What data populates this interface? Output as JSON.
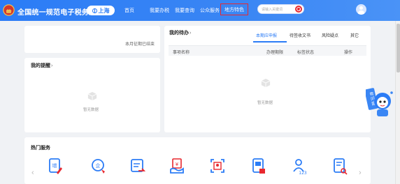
{
  "header": {
    "brand": "全国统一规范电子税务局",
    "region": "上海",
    "nav": [
      {
        "label": "首页"
      },
      {
        "label": "我要办税"
      },
      {
        "label": "我要查询"
      },
      {
        "label": "公众服务"
      },
      {
        "label": "地方特色"
      }
    ],
    "search": {
      "placeholder": "请输入关键词"
    },
    "colors": {
      "primary": "#2b7cf6",
      "highlight": "#e8282f"
    }
  },
  "summary_card": {
    "month_status": "本月征期已结束"
  },
  "reminder_card": {
    "title": "我的提醒",
    "empty_text": "暂无数据"
  },
  "todo_card": {
    "title": "我的待办",
    "tabs": [
      {
        "label": "本期应申报",
        "active": true
      },
      {
        "label": "待签收文书"
      },
      {
        "label": "风险疑点"
      },
      {
        "label": "其它"
      }
    ],
    "columns": [
      "事项名称",
      "办理期限",
      "标签状态",
      "操作"
    ],
    "empty_text": "暂无数据"
  },
  "hot_services": {
    "title": "热门服务",
    "items": [
      {
        "icon": "tax-filing-icon"
      },
      {
        "icon": "enterprise-icon"
      },
      {
        "icon": "invoice-transfer-icon"
      },
      {
        "icon": "tax-payment-icon"
      },
      {
        "icon": "id-scan-icon"
      },
      {
        "icon": "invoice-scan-icon"
      },
      {
        "icon": "user-number-icon"
      },
      {
        "icon": "document-search-icon"
      }
    ]
  },
  "assistant": {
    "bubble_text": "有问题找我聊"
  }
}
